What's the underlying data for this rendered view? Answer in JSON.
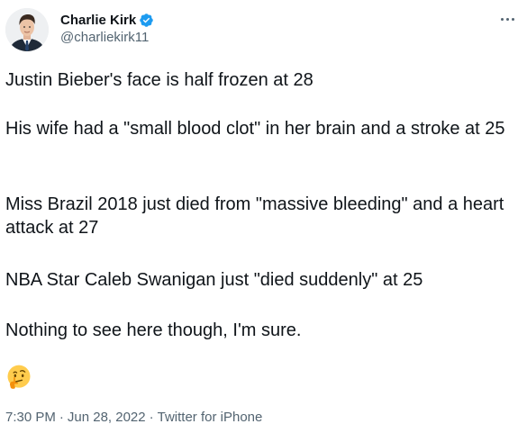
{
  "author": {
    "display_name": "Charlie Kirk",
    "handle": "@charliekirk11",
    "verified": true
  },
  "tweet": {
    "paragraphs": [
      "Justin Bieber's face is half frozen at 28",
      "His wife had a \"small blood clot\" in her brain and a stroke at 25",
      "Miss Brazil 2018 just died from \"massive bleeding\" and a heart attack at 27",
      "NBA Star Caleb Swanigan just \"died suddenly\" at 25",
      "Nothing to see here though, I'm sure."
    ],
    "emoji": "thinking-face"
  },
  "meta": {
    "time": "7:30 PM",
    "date": "Jun 28, 2022",
    "source": "Twitter for iPhone"
  },
  "colors": {
    "text": "#0f1419",
    "secondary": "#536471",
    "verified": "#1d9bf0"
  }
}
